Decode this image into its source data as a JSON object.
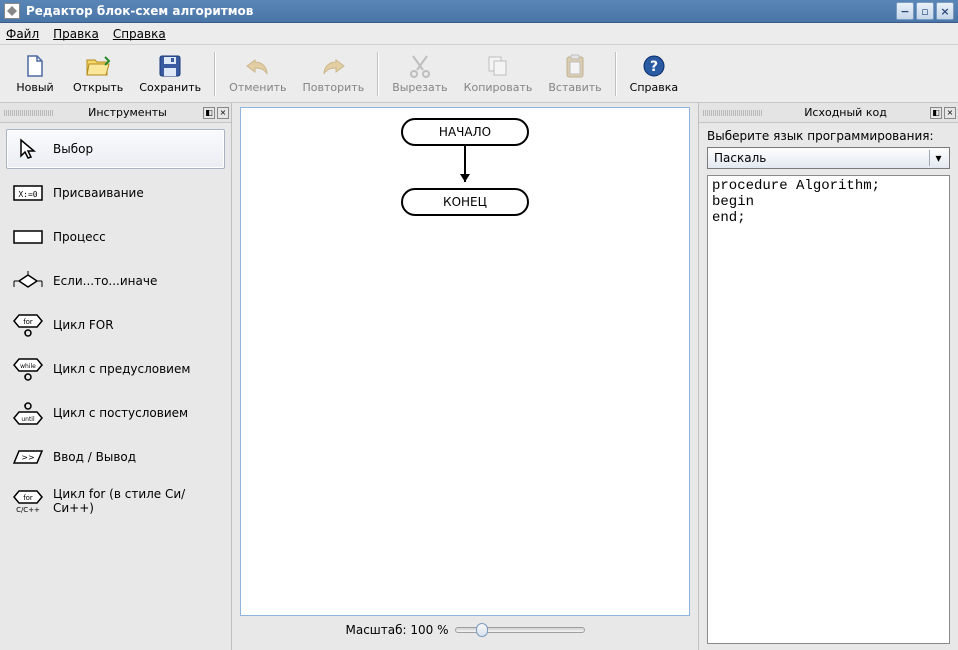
{
  "window": {
    "title": "Редактор блок-схем алгоритмов"
  },
  "menu": {
    "file": "Файл",
    "edit": "Правка",
    "help": "Справка"
  },
  "toolbar": {
    "new": "Новый",
    "open": "Открыть",
    "save": "Сохранить",
    "undo": "Отменить",
    "redo": "Повторить",
    "cut": "Вырезать",
    "copy": "Копировать",
    "paste": "Вставить",
    "help": "Справка"
  },
  "dock_tools": {
    "title": "Инструменты",
    "items": [
      {
        "label": "Выбор",
        "selected": true
      },
      {
        "label": "Присваивание"
      },
      {
        "label": "Процесс"
      },
      {
        "label": "Если...то...иначе"
      },
      {
        "label": "Цикл FOR"
      },
      {
        "label": "Цикл с предусловием"
      },
      {
        "label": "Цикл с постусловием"
      },
      {
        "label": "Ввод / Вывод"
      },
      {
        "label": "Цикл for (в стиле Си/Си++)"
      }
    ]
  },
  "canvas": {
    "node_start": "НАЧАЛО",
    "node_end": "КОНЕЦ",
    "zoom_label": "Масштаб: 100 %"
  },
  "dock_code": {
    "title": "Исходный код",
    "lang_prompt": "Выберите язык программирования:",
    "lang_selected": "Паскаль",
    "code": "procedure Algorithm;\nbegin\nend;"
  }
}
